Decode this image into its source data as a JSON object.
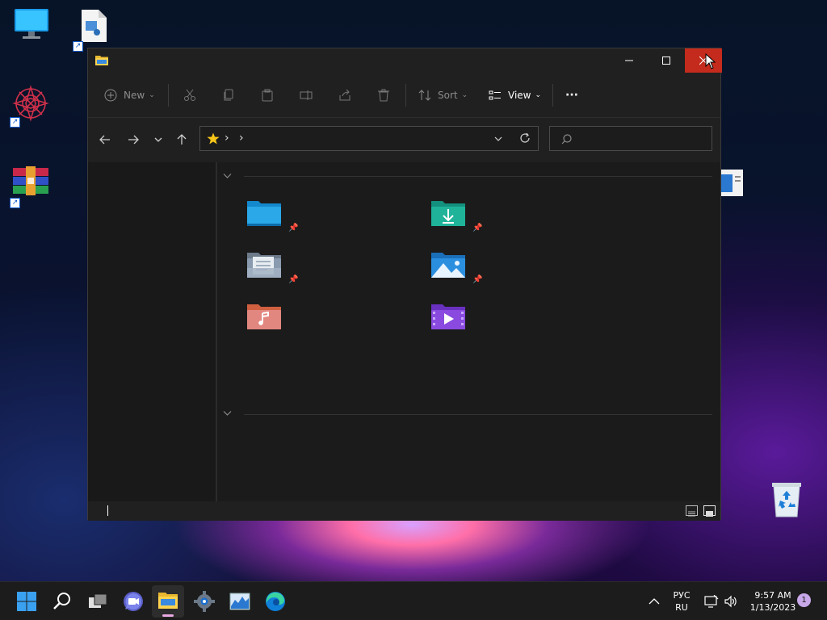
{
  "desktop": {
    "icons": [
      {
        "name": "this-pc-icon"
      },
      {
        "name": "media-file-icon"
      },
      {
        "name": "artwork-shortcut-icon"
      },
      {
        "name": "winrar-shortcut-icon"
      },
      {
        "name": "recycle-bin-icon"
      }
    ]
  },
  "explorer": {
    "toolbar": {
      "new_label": "New",
      "sort_label": "Sort",
      "view_label": "View",
      "more_label": "···"
    },
    "address": {
      "separator_1": "›",
      "separator_2": "›"
    },
    "search": {
      "placeholder": ""
    },
    "quick_access": [
      {
        "icon": "desktop-folder-icon",
        "color": "#2aa8e8",
        "pinned": true
      },
      {
        "icon": "downloads-folder-icon",
        "color": "#1fb39a",
        "pinned": true
      },
      {
        "icon": "documents-folder-icon",
        "color": "#8a9bb0",
        "pinned": true
      },
      {
        "icon": "pictures-folder-icon",
        "color": "#2b8fe0",
        "pinned": true
      },
      {
        "icon": "music-folder-icon",
        "color": "#e87a5a",
        "pinned": false
      },
      {
        "icon": "videos-folder-icon",
        "color": "#8a4ae0",
        "pinned": false
      }
    ]
  },
  "taskbar": {
    "lang_top": "РУС",
    "lang_bottom": "RU",
    "time": "9:57 AM",
    "date": "1/13/2023",
    "notification_count": "1"
  },
  "colors": {
    "close_button": "#c42b1c",
    "window_bg": "#202020",
    "taskbar_bg": "#1c1c1c",
    "accent": "#0067c0"
  }
}
